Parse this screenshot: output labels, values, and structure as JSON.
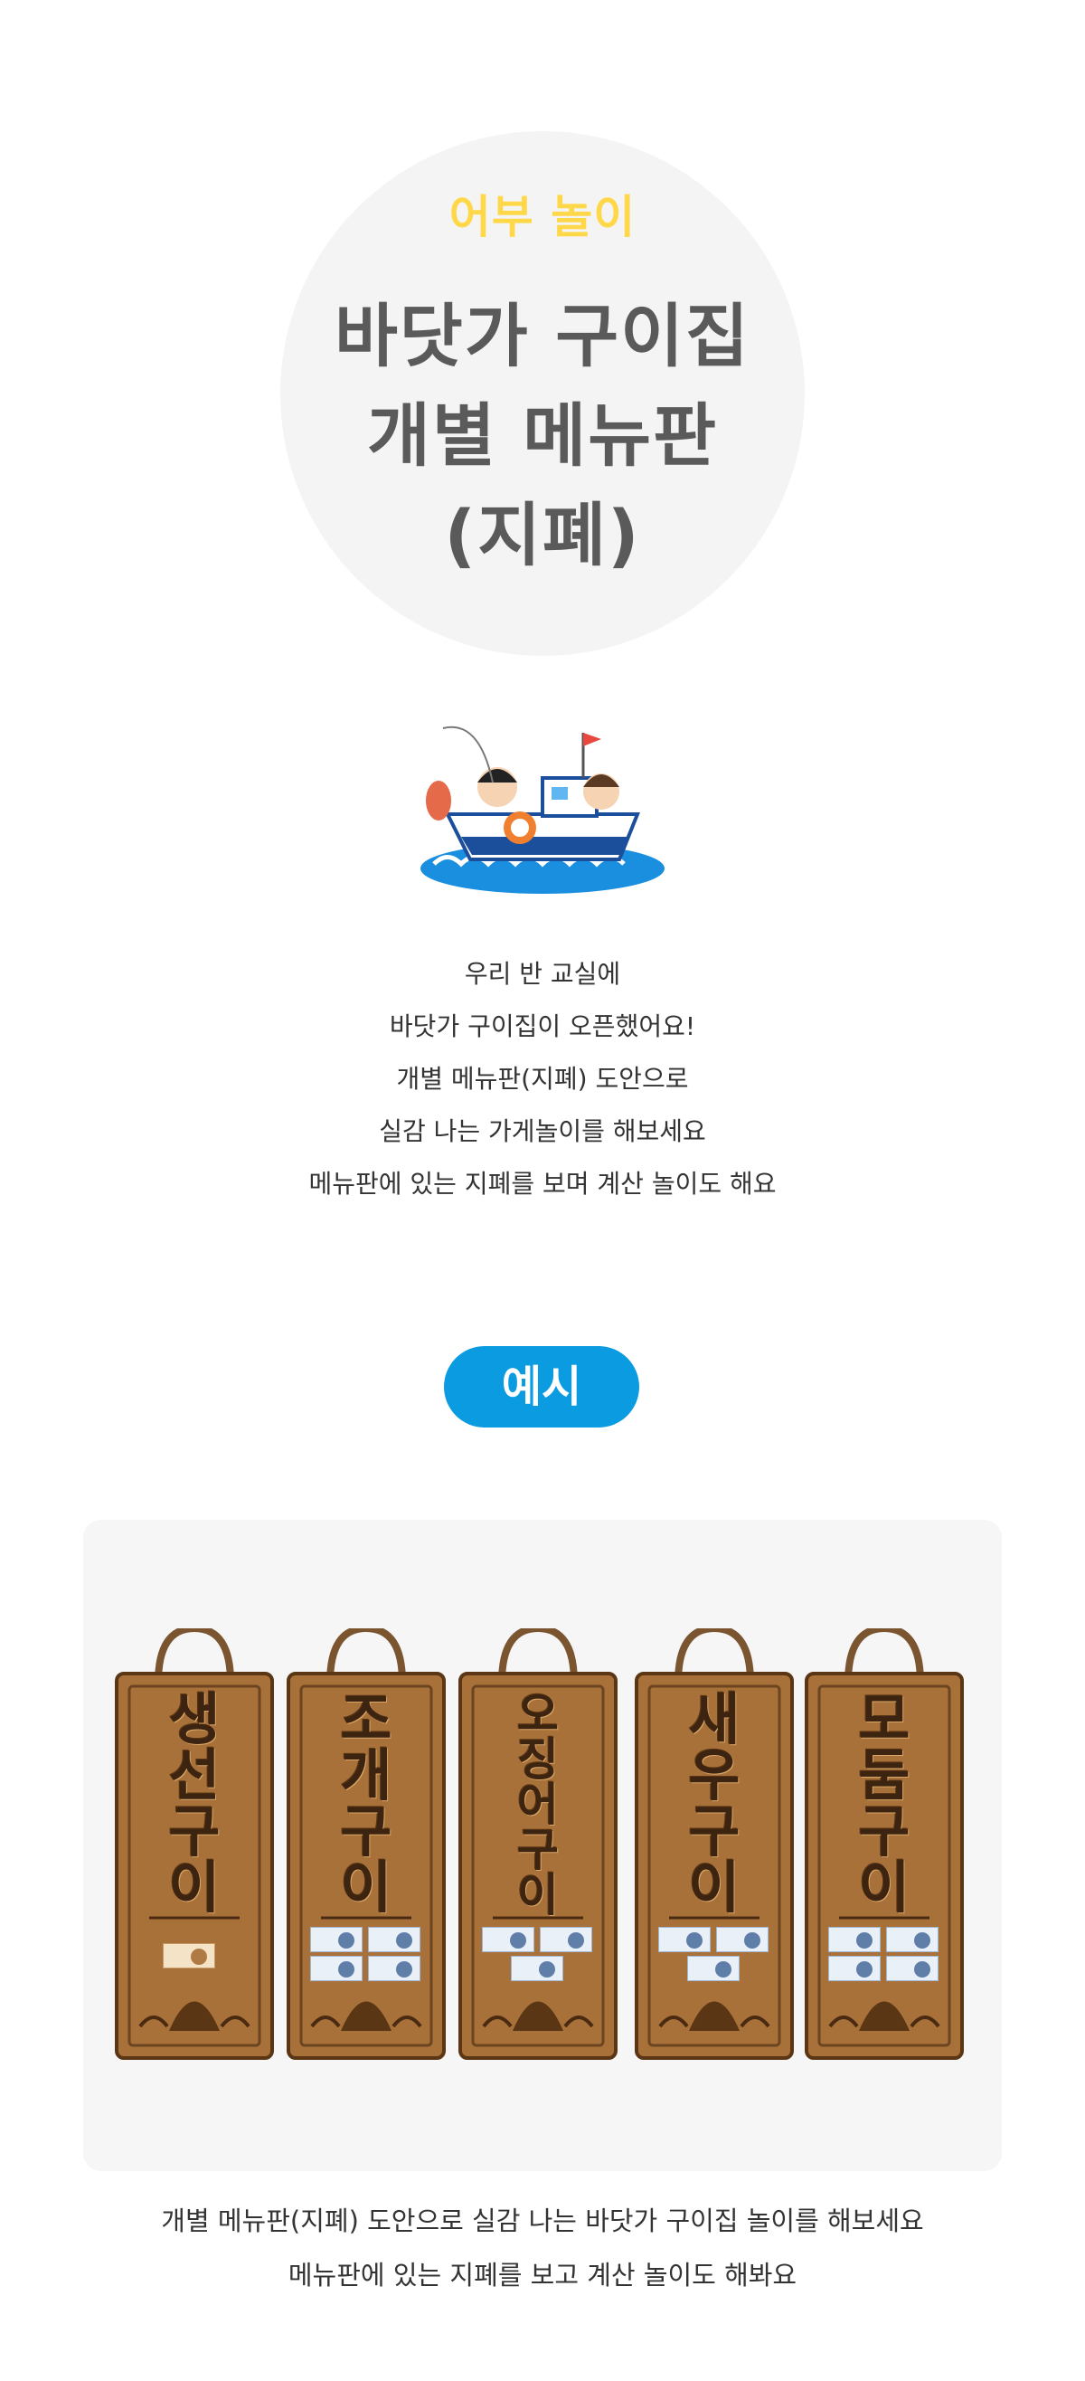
{
  "hero": {
    "subtitle": "어부 놀이",
    "title_lines": [
      "바닷가 구이집",
      "개별 메뉴판",
      "(지폐)"
    ]
  },
  "intro": {
    "lines": [
      "우리 반 교실에",
      "바닷가 구이집이 오픈했어요!",
      "개별 메뉴판(지폐) 도안으로",
      "실감 나는 가게놀이를 해보세요",
      "메뉴판에 있는 지폐를 보며 계산 놀이도 해요"
    ]
  },
  "example_label": "예시",
  "signs": [
    {
      "name": "생선구이",
      "chars": [
        "생",
        "선",
        "구",
        "이"
      ],
      "bills": 1
    },
    {
      "name": "조개구이",
      "chars": [
        "조",
        "개",
        "구",
        "이"
      ],
      "bills": 4
    },
    {
      "name": "오징어구이",
      "chars": [
        "오",
        "징",
        "어",
        "구",
        "이"
      ],
      "bills": 3
    },
    {
      "name": "새우구이",
      "chars": [
        "새",
        "우",
        "구",
        "이"
      ],
      "bills": 3
    },
    {
      "name": "모둠구이",
      "chars": [
        "모",
        "둠",
        "구",
        "이"
      ],
      "bills": 4
    }
  ],
  "caption": {
    "lines": [
      "개별 메뉴판(지폐) 도안으로 실감 나는 바닷가 구이집 놀이를 해보세요",
      "메뉴판에 있는 지폐를 보고 계산 놀이도 해봐요"
    ]
  },
  "colors": {
    "subtitle": "#ffd84a",
    "title": "#5a5a5a",
    "pill": "#0a9be0",
    "wood": "#a9713a"
  }
}
